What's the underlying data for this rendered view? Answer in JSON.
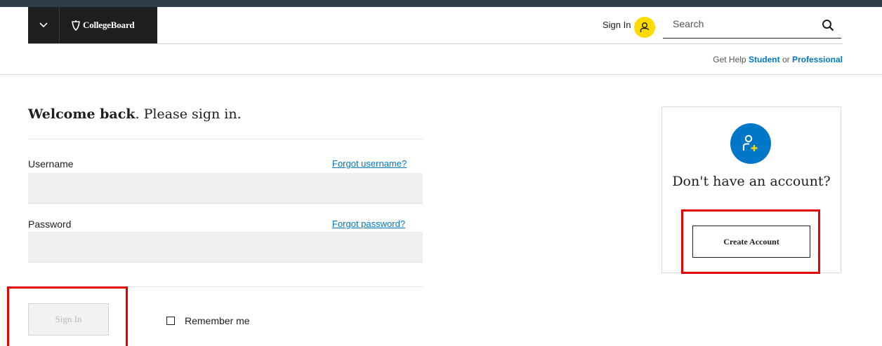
{
  "header": {
    "logo_text": "CollegeBoard",
    "sign_in_label": "Sign In",
    "search_placeholder": "Search",
    "help_prefix": "Get Help",
    "help_student": "Student",
    "help_or": "or",
    "help_professional": "Professional"
  },
  "login": {
    "welcome_bold": "Welcome back",
    "welcome_rest": ". Please sign in.",
    "username_label": "Username",
    "forgot_username": "Forgot username?",
    "username_value": "",
    "password_label": "Password",
    "forgot_password": "Forgot password?",
    "password_value": "",
    "sign_in_button": "Sign In",
    "remember_me": "Remember me",
    "remember_checked": false
  },
  "card": {
    "title": "Don't have an account?",
    "create_account_button": "Create Account"
  },
  "colors": {
    "brand_dark": "#1e1e1e",
    "accent_yellow": "#fedb00",
    "link_blue": "#0077c8",
    "highlight_red": "#e20000"
  }
}
